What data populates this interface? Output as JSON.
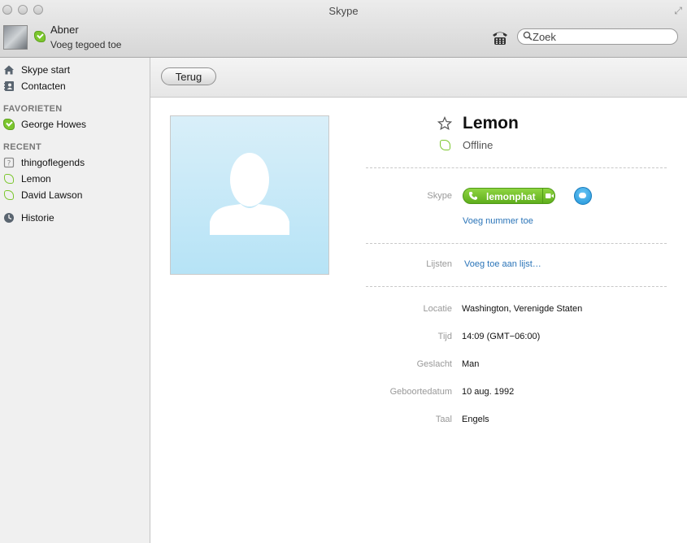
{
  "window": {
    "title": "Skype"
  },
  "user": {
    "name": "Abner",
    "credit_link": "Voeg tegoed toe"
  },
  "search": {
    "placeholder": "Zoek"
  },
  "sidebar": {
    "nav": [
      {
        "label": "Skype start",
        "icon": "home-icon"
      },
      {
        "label": "Contacten",
        "icon": "address-book-icon"
      }
    ],
    "favorites_header": "FAVORIETEN",
    "favorites": [
      {
        "label": "George Howes",
        "status": "online"
      }
    ],
    "recent_header": "RECENT",
    "recent": [
      {
        "label": "thingoflegends",
        "status": "unknown"
      },
      {
        "label": "Lemon",
        "status": "offline"
      },
      {
        "label": "David Lawson",
        "status": "offline"
      }
    ],
    "history": {
      "label": "Historie",
      "icon": "clock-icon"
    }
  },
  "toolbar": {
    "back_label": "Terug"
  },
  "contact": {
    "name": "Lemon",
    "status": "Offline",
    "skype_label": "Skype",
    "skype_name": "lemonphat",
    "add_number_link": "Voeg nummer toe",
    "lists_label": "Lijsten",
    "add_to_list_link": "Voeg toe aan lijst…",
    "fields": [
      {
        "label": "Locatie",
        "value": "Washington, Verenigde Staten"
      },
      {
        "label": "Tijd",
        "value": "14:09 (GMT−06:00)"
      },
      {
        "label": "Geslacht",
        "value": "Man"
      },
      {
        "label": "Geboortedatum",
        "value": "10 aug. 1992"
      },
      {
        "label": "Taal",
        "value": "Engels"
      }
    ]
  },
  "colors": {
    "online_green": "#7bc62d",
    "link_blue": "#2a74b8",
    "call_green": "#5fae1c",
    "chat_blue": "#1f93d8"
  }
}
